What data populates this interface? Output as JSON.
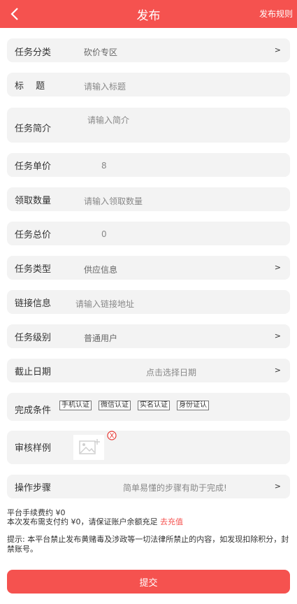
{
  "header": {
    "title": "发布",
    "rules_link": "发布规则"
  },
  "form": {
    "category": {
      "label": "任务分类",
      "value": "砍价专区",
      "chevron": ">"
    },
    "title": {
      "label": "标　 题",
      "placeholder": "请输入标题"
    },
    "intro": {
      "label": "任务简介",
      "placeholder": "请输入简介"
    },
    "unit_price": {
      "label": "任务单价",
      "value": "8"
    },
    "quantity": {
      "label": "领取数量",
      "placeholder": "请输入领取数量"
    },
    "total_price": {
      "label": "任务总价",
      "value": "0"
    },
    "task_type": {
      "label": "任务类型",
      "value": "供应信息",
      "chevron": ">"
    },
    "link": {
      "label": "链接信息",
      "placeholder": "请输入链接地址"
    },
    "level": {
      "label": "任务级别",
      "value": "普通用户",
      "chevron": ">"
    },
    "deadline": {
      "label": "截止日期",
      "placeholder": "点击选择日期",
      "chevron": ">"
    },
    "conditions": {
      "label": "完成条件",
      "tags": [
        "手机认证",
        "微信认证",
        "实名认证",
        "身份证认"
      ]
    },
    "sample": {
      "label": "审核样例",
      "close_glyph": "X"
    },
    "steps": {
      "label": "操作步骤",
      "placeholder": "简单易懂的步骤有助于完成!",
      "chevron": ">"
    }
  },
  "fees": {
    "platform_fee": "平台手续费约 ¥0",
    "payment_note": "本次发布需支付约 ¥0，请保证账户余额充足 ",
    "recharge_link": "去充值"
  },
  "notice": "提示: 本平台禁止发布黄赌毒及涉政等一切法律所禁止的内容，如发现扣除积分，封禁账号。",
  "submit_label": "提交",
  "colors": {
    "accent": "#f5524f",
    "row_bg": "#f3f3f3"
  }
}
